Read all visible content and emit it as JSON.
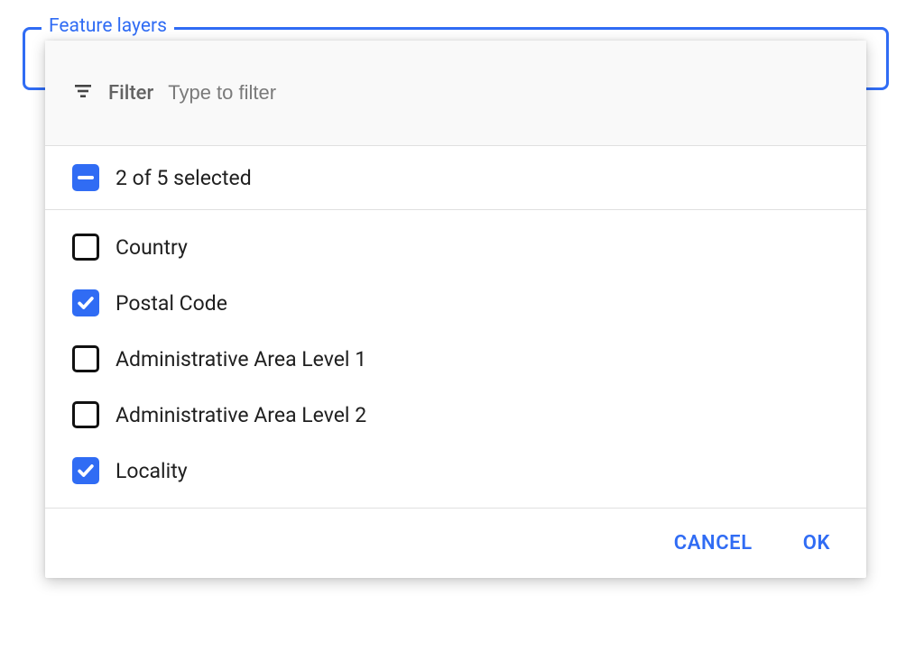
{
  "field": {
    "legend": "Feature layers"
  },
  "filter": {
    "label": "Filter",
    "placeholder": "Type to filter",
    "value": ""
  },
  "summary": {
    "text": "2 of 5 selected"
  },
  "options": [
    {
      "label": "Country",
      "checked": false
    },
    {
      "label": "Postal Code",
      "checked": true
    },
    {
      "label": "Administrative Area Level 1",
      "checked": false
    },
    {
      "label": "Administrative Area Level 2",
      "checked": false
    },
    {
      "label": "Locality",
      "checked": true
    }
  ],
  "actions": {
    "cancel": "CANCEL",
    "ok": "OK"
  },
  "colors": {
    "accent": "#306cf4"
  }
}
